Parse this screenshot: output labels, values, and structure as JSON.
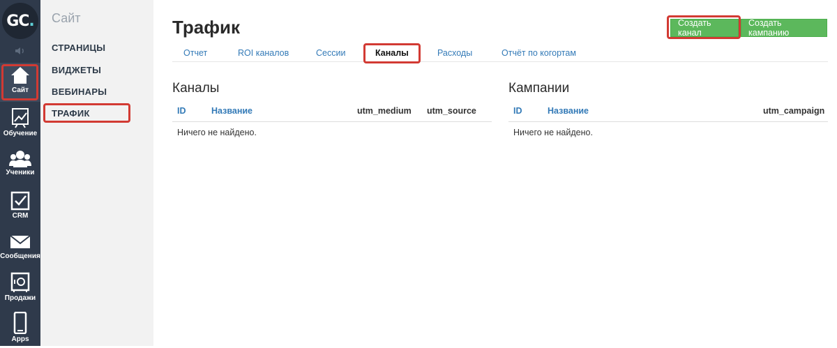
{
  "logo": {
    "text_a": "GC",
    "text_b": "."
  },
  "rail": {
    "items": [
      {
        "label": "Сайт",
        "icon": "home-icon"
      },
      {
        "label": "Обучение",
        "icon": "chart-icon"
      },
      {
        "label": "Ученики",
        "icon": "users-icon"
      },
      {
        "label": "CRM",
        "icon": "checkbox-icon"
      },
      {
        "label": "Сообщения",
        "icon": "envelope-icon"
      },
      {
        "label": "Продажи",
        "icon": "safe-icon"
      },
      {
        "label": "Apps",
        "icon": "phone-icon"
      }
    ]
  },
  "section": {
    "title": "Сайт",
    "items": [
      "СТРАНИЦЫ",
      "ВИДЖЕТЫ",
      "ВЕБИНАРЫ",
      "ТРАФИК"
    ]
  },
  "header": {
    "title": "Трафик",
    "create_channel": "Создать канал",
    "create_campaign": "Создать кампанию"
  },
  "tabs": [
    "Отчет",
    "ROI каналов",
    "Сессии",
    "Каналы",
    "Расходы",
    "Отчёт по когортам"
  ],
  "channels": {
    "heading": "Каналы",
    "columns": [
      "ID",
      "Название",
      "utm_medium",
      "utm_source"
    ],
    "empty": "Ничего не найдено."
  },
  "campaigns": {
    "heading": "Кампании",
    "columns": [
      "ID",
      "Название",
      "utm_campaign"
    ],
    "empty": "Ничего не найдено."
  },
  "colors": {
    "rail": "#2f3a4b",
    "accent_green": "#5cb85c",
    "highlight_red": "#d23a33",
    "link": "#337ab7"
  }
}
